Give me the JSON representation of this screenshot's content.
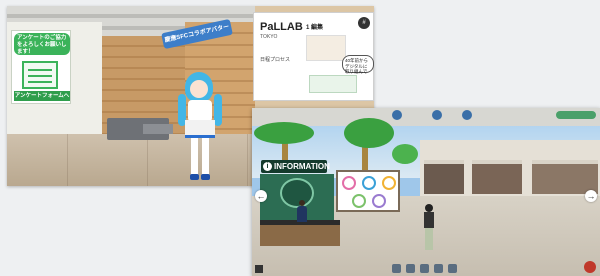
{
  "screenshot_a": {
    "survey_panel": {
      "bubble_text": "アンケートのご協力をよろしくお願いします！",
      "footer_text": "アンケートフォームへ"
    },
    "collab_ribbon": "慶應SFCコラボアバター",
    "sign": {
      "logo": "PaLLAB",
      "city": "TOKYO",
      "chapter": "1 編集",
      "left_label": "日程プロセス",
      "speech": "40年前からデジタルに取り組んでいる",
      "hash_icon": "#"
    }
  },
  "screenshot_b": {
    "info_board": "INFORMATION",
    "info_icon": "i",
    "nav_left": "←",
    "nav_right": "→"
  }
}
